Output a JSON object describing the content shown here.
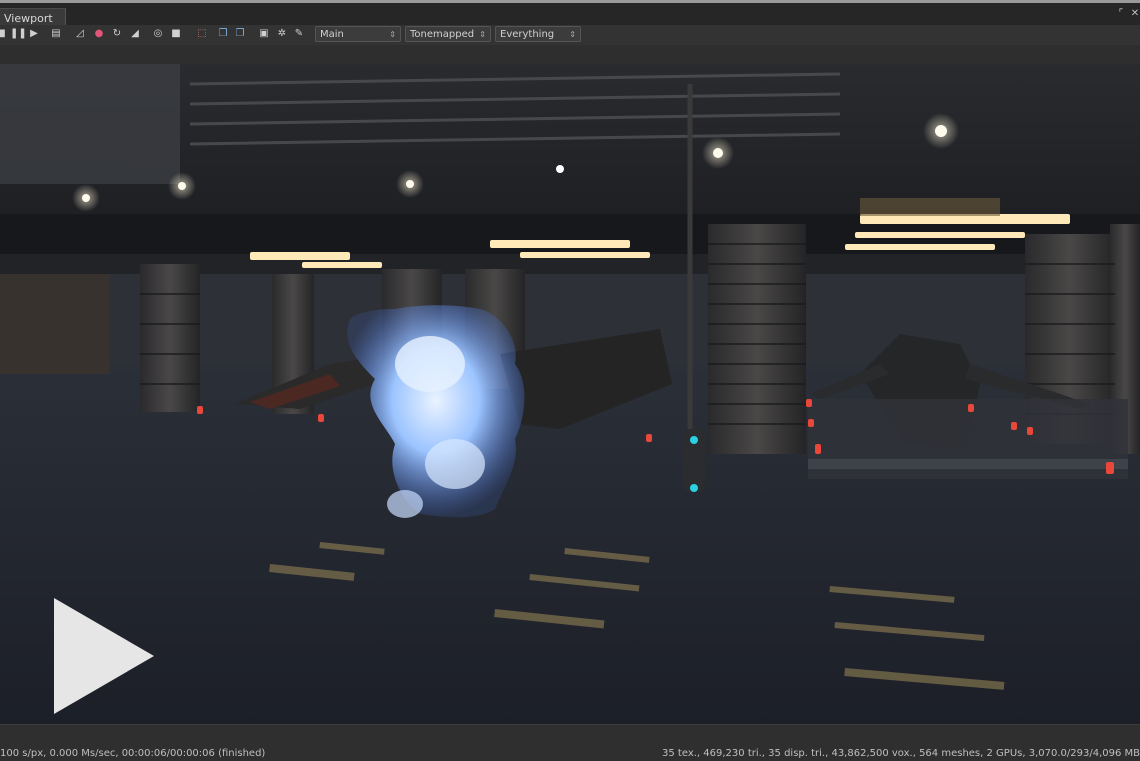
{
  "window": {
    "tab_label": "Viewport"
  },
  "toolbar": {
    "tools": [
      {
        "icon": "stop-icon",
        "glyph": "■"
      },
      {
        "icon": "pause-icon",
        "glyph": "❚❚"
      },
      {
        "icon": "play-icon",
        "glyph": "▶"
      },
      {
        "icon": "screenshot-icon",
        "glyph": "▤"
      },
      {
        "icon": "render-region-icon",
        "glyph": "◿"
      },
      {
        "icon": "color-picker-icon",
        "glyph": "●"
      },
      {
        "icon": "refresh-icon",
        "glyph": "↻"
      },
      {
        "icon": "pixel-filter-icon",
        "glyph": "◢"
      },
      {
        "icon": "lock-camera-icon",
        "glyph": "◎"
      },
      {
        "icon": "clear-icon",
        "glyph": "■"
      },
      {
        "icon": "interactive-region-icon",
        "glyph": "⬚"
      },
      {
        "icon": "copy-icon",
        "glyph": "❐"
      },
      {
        "icon": "duplicate-icon",
        "glyph": "❐"
      },
      {
        "icon": "display-icon",
        "glyph": "▣"
      },
      {
        "icon": "settings-icon",
        "glyph": "✲"
      },
      {
        "icon": "wrench-icon",
        "glyph": "✎"
      }
    ],
    "camera_dropdown": "Main",
    "display_dropdown": "Tonemapped",
    "layers_dropdown": "Everything"
  },
  "status": {
    "left": "100 s/px, 0.000 Ms/sec, 00:00:06/00:00:06 (finished)",
    "right": "35 tex., 469,230 tri., 35 disp. tri., 43,862,500 vox., 564 meshes, 2 GPUs, 3,070.0/293/4,096 MB"
  },
  "colors": {
    "accent_red": "#e8473a",
    "flame_blue": "#7fb2ff",
    "panel": "#333333"
  }
}
